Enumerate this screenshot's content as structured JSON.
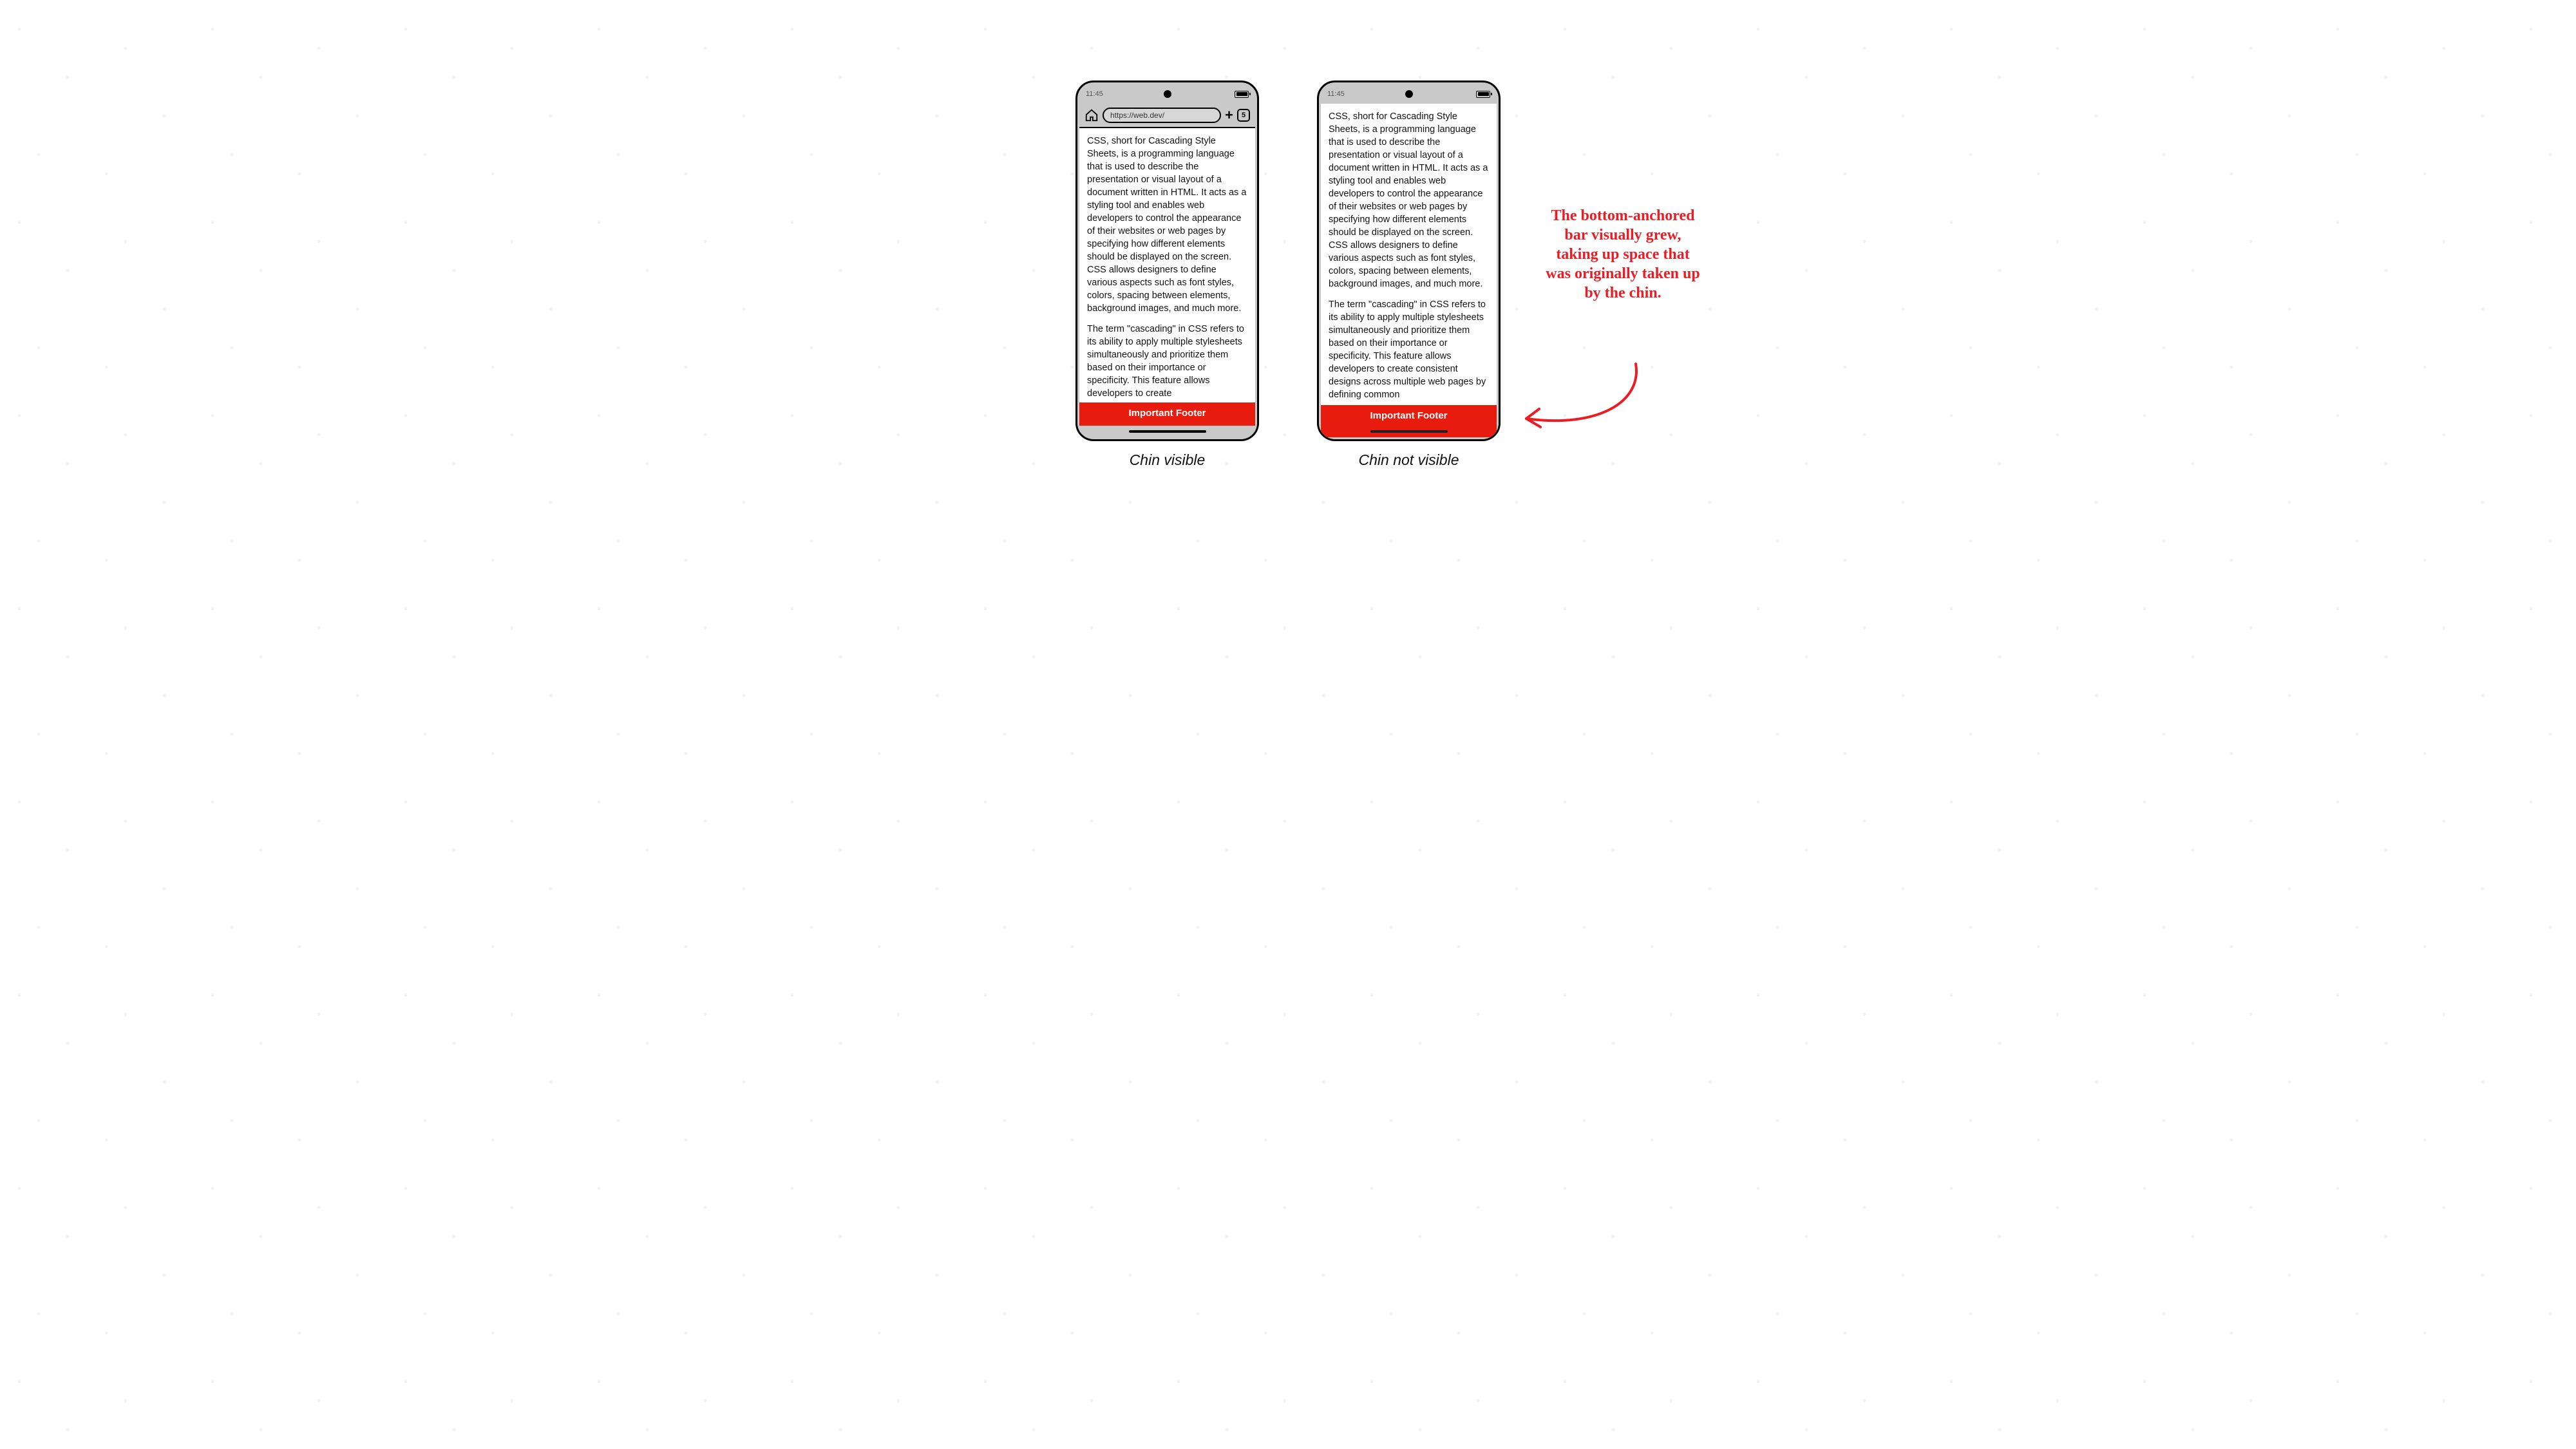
{
  "status": {
    "time": "11:45"
  },
  "browser": {
    "url": "https://web.dev/",
    "tab_count": "5"
  },
  "content": {
    "para1": "CSS, short for Cascading Style Sheets, is a programming language that is used to describe the presentation or visual layout of a document written in HTML. It acts as a styling tool and enables web developers to control the appearance of their websites or web pages by specifying how different elements should be displayed on the screen. CSS allows designers to define various aspects such as font styles, colors, spacing between elements, background images, and much more.",
    "para2a": "The term \"cascading\" in CSS refers to its ability to apply multiple stylesheets simultaneously and prioritize them based on their importance or specificity. This feature allows developers to create",
    "para2b": "The term \"cascading\" in CSS refers to its ability to apply multiple stylesheets simultaneously and prioritize them based on their importance or specificity. This feature allows developers to create consistent designs across multiple web pages by defining common"
  },
  "footer": {
    "label": "Important Footer"
  },
  "captions": {
    "a": "Chin visible",
    "b": "Chin not visible"
  },
  "annotation": {
    "text": "The bottom-anchored bar visually grew, taking up space that was originally taken up by the chin."
  },
  "colors": {
    "accent_red": "#e81c0e",
    "annotation_red": "#ec1c24"
  }
}
